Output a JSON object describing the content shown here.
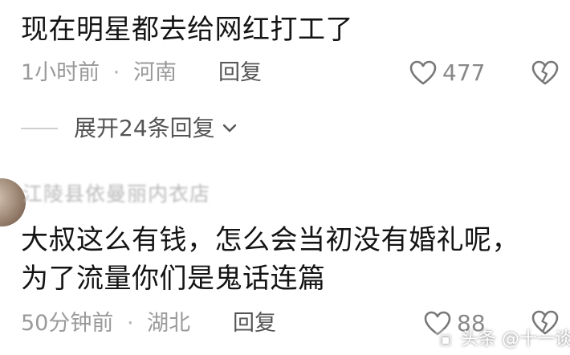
{
  "comments": [
    {
      "text": "现在明星都去给网红打工了",
      "time": "1小时前",
      "separator": "·",
      "location": "河南",
      "reply_label": "回复",
      "likes": "477",
      "like_icon": "heart-outline-icon",
      "dislike_icon": "broken-heart-icon"
    },
    {
      "username": "江陵县依曼丽内衣店",
      "text_line1": "大叔这么有钱，怎么会当初没有婚礼呢，",
      "text_line2": "为了流量你们是鬼话连篇",
      "time": "50分钟前",
      "separator": "·",
      "location": "湖北",
      "reply_label": "回复",
      "likes": "88",
      "like_icon": "heart-outline-icon",
      "dislike_icon": "broken-heart-icon"
    }
  ],
  "expand_replies": {
    "label": "展开24条回复",
    "icon": "chevron-down-icon"
  },
  "watermark": {
    "text": "头条 @十一谈娱",
    "icon": "toutiao-logo-icon"
  }
}
